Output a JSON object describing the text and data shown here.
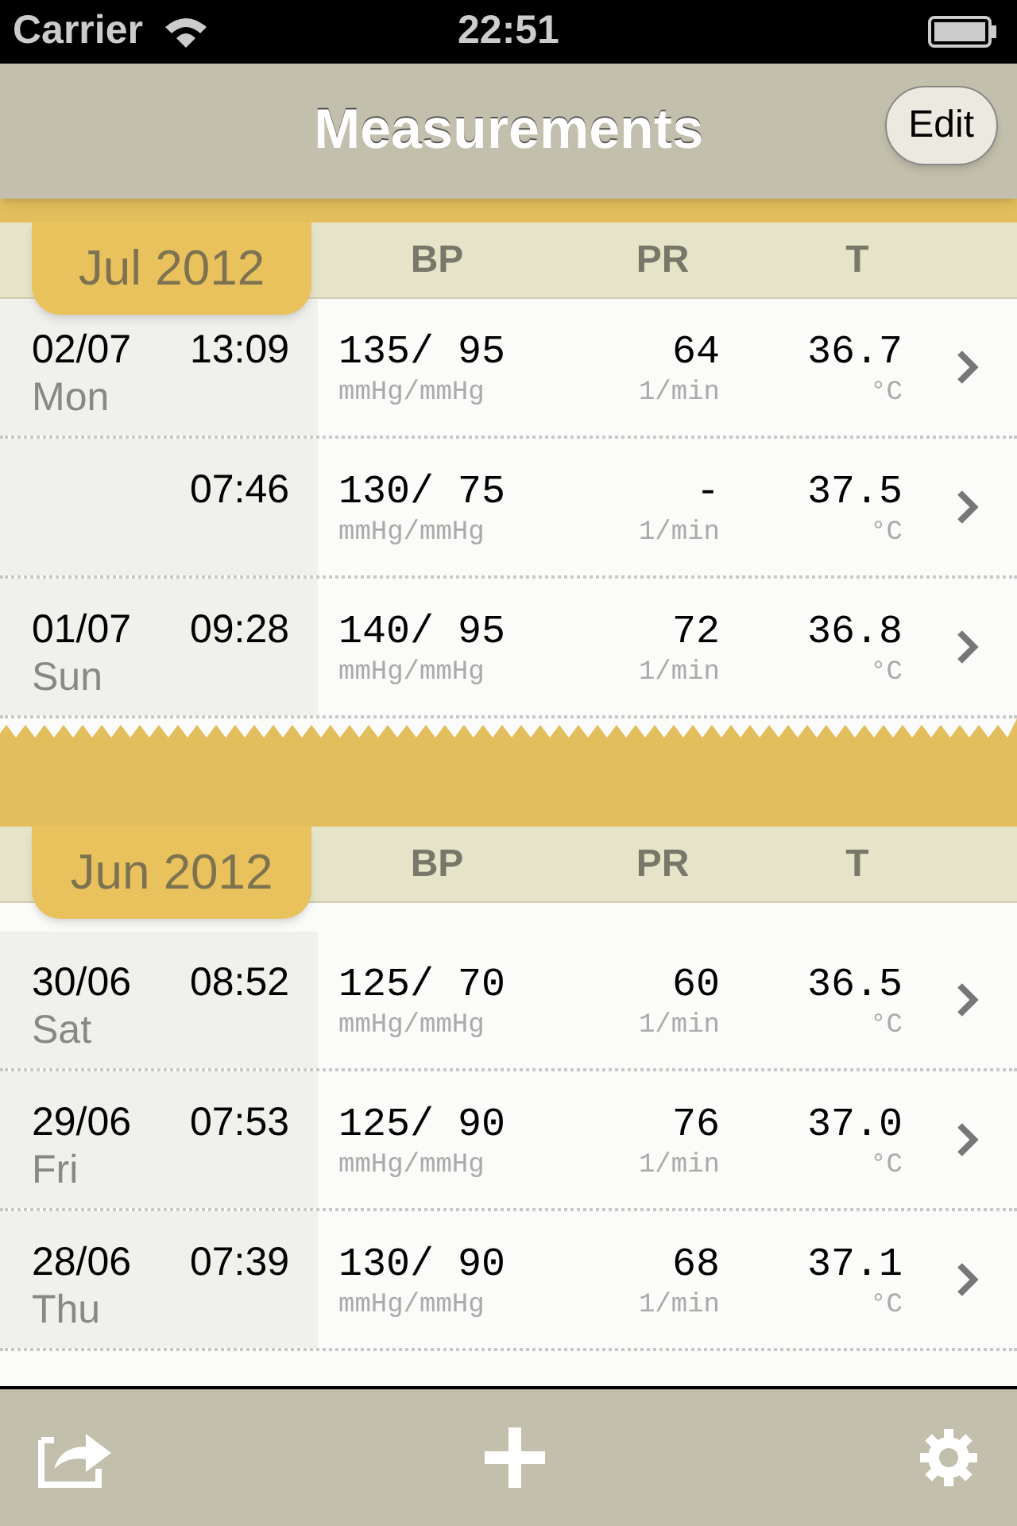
{
  "status_bar": {
    "carrier": "Carrier",
    "time": "22:51"
  },
  "nav": {
    "title": "Measurements",
    "edit_button": "Edit"
  },
  "sections": [
    {
      "month": "Jul 2012",
      "columns": [
        "BP",
        "PR",
        "T"
      ],
      "rows": [
        {
          "date": "02/07",
          "day": "Mon",
          "time": "13:09",
          "bp": "135/ 95",
          "bp_unit": "mmHg/mmHg",
          "pr": "64",
          "pr_unit": "1/min",
          "t": "36.7",
          "t_unit": "°C"
        },
        {
          "time": "07:46",
          "bp": "130/ 75",
          "bp_unit": "mmHg/mmHg",
          "pr": "-",
          "pr_unit": "1/min",
          "t": "37.5",
          "t_unit": "°C"
        },
        {
          "date": "01/07",
          "day": "Sun",
          "time": "09:28",
          "bp": "140/ 95",
          "bp_unit": "mmHg/mmHg",
          "pr": "72",
          "pr_unit": "1/min",
          "t": "36.8",
          "t_unit": "°C"
        }
      ]
    },
    {
      "month": "Jun 2012",
      "columns": [
        "BP",
        "PR",
        "T"
      ],
      "rows": [
        {
          "date": "30/06",
          "day": "Sat",
          "time": "08:52",
          "bp": "125/ 70",
          "bp_unit": "mmHg/mmHg",
          "pr": "60",
          "pr_unit": "1/min",
          "t": "36.5",
          "t_unit": "°C"
        },
        {
          "date": "29/06",
          "day": "Fri",
          "time": "07:53",
          "bp": "125/ 90",
          "bp_unit": "mmHg/mmHg",
          "pr": "76",
          "pr_unit": "1/min",
          "t": "37.0",
          "t_unit": "°C"
        },
        {
          "date": "28/06",
          "day": "Thu",
          "time": "07:39",
          "bp": "130/ 90",
          "bp_unit": "mmHg/mmHg",
          "pr": "68",
          "pr_unit": "1/min",
          "t": "37.1",
          "t_unit": "°C"
        }
      ]
    }
  ]
}
